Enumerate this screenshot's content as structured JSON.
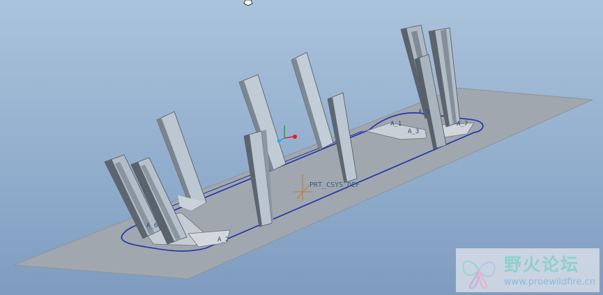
{
  "viewport": {
    "background_top": "#aac3dc",
    "background_bottom": "#7f9cc0"
  },
  "model": {
    "plate_color": "#9ea6ae",
    "pillar_color": "#b7c3cf",
    "outline_color": "#1f2fa8"
  },
  "labels": {
    "csys": "PRT_CSYS_DEF",
    "datum_a": "A_5",
    "datum_b": "A_1",
    "datum_c": "A_3",
    "datum_d": "A_7",
    "datum_e": "A_6",
    "datum_f": "A_2"
  },
  "watermark": {
    "title": "野火论坛",
    "url": "www.proewildfire.cn"
  }
}
